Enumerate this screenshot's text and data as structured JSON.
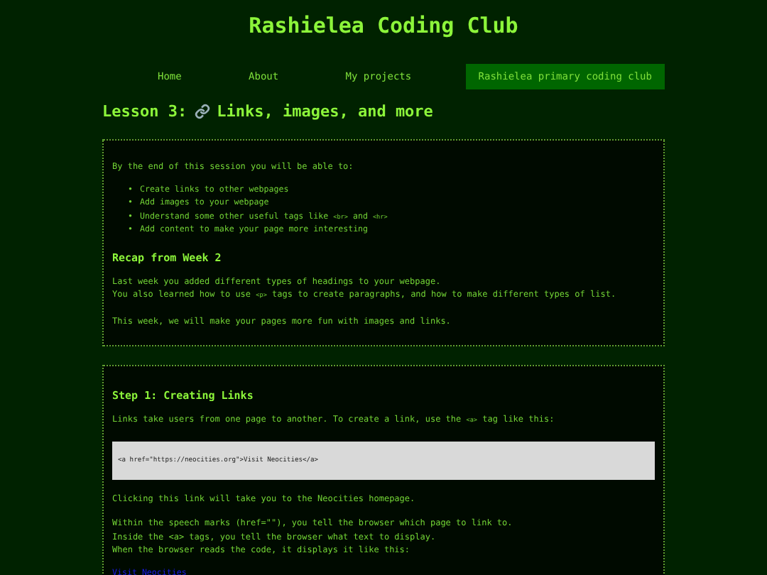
{
  "site_title": "Rashielea Coding Club",
  "nav": [
    {
      "label": "Home",
      "selected": false
    },
    {
      "label": "About",
      "selected": false
    },
    {
      "label": "My projects",
      "selected": false
    },
    {
      "label": "Rashielea primary coding club",
      "selected": true
    }
  ],
  "lesson_title": {
    "before": "Lesson 3:",
    "after": "Links, images, and more"
  },
  "intro": {
    "lead": "By the end of this session you will be able to:",
    "goals": [
      {
        "bullet": "•",
        "parts": [
          {
            "kind": "text",
            "text": "Create links to other webpages"
          }
        ]
      },
      {
        "bullet": "•",
        "parts": [
          {
            "kind": "text",
            "text": "Add images to your webpage"
          }
        ]
      },
      {
        "bullet": "•",
        "parts": [
          {
            "kind": "text",
            "text": "Understand some other useful tags like "
          },
          {
            "kind": "code",
            "text": "<br>"
          },
          {
            "kind": "text",
            "text": " and "
          },
          {
            "kind": "code",
            "text": "<hr>"
          }
        ]
      },
      {
        "bullet": "•",
        "parts": [
          {
            "kind": "text",
            "text": "Add content to make your page more interesting"
          }
        ]
      }
    ],
    "recap_heading": "Recap from Week 2",
    "recap": [
      [
        {
          "kind": "text",
          "text": "Last week you added different types of headings to your webpage."
        },
        {
          "kind": "break"
        },
        {
          "kind": "text",
          "text": "You also learned how to use "
        },
        {
          "kind": "code",
          "text": "<p>"
        },
        {
          "kind": "text",
          "text": " tags to create paragraphs, and how to make different types of list."
        }
      ],
      [
        {
          "kind": "text",
          "text": "This week, we will make your pages more fun with images and links."
        }
      ]
    ]
  },
  "step1": {
    "heading": "Step 1: Creating Links",
    "before_code": [
      {
        "kind": "text",
        "text": "Links take users from one page to another. To create a link, use the "
      },
      {
        "kind": "code",
        "text": "<a>"
      },
      {
        "kind": "text",
        "text": " tag like this:"
      }
    ],
    "code": "<a href=\"https://neocities.org\">Visit Neocities</a>",
    "after_code": [
      [
        {
          "kind": "text",
          "text": "Clicking this link will take you to the Neocities homepage."
        }
      ],
      [
        {
          "kind": "text",
          "text": "Within the speech marks (href=\"\"), you tell the browser which page to link to."
        },
        {
          "kind": "break"
        },
        {
          "kind": "text",
          "text": "Inside the <a> tags, you tell the browser what text to display."
        },
        {
          "kind": "break"
        },
        {
          "kind": "text",
          "text": "When the browser reads the code, it displays it like this:"
        }
      ]
    ],
    "link": "Visit Neocities"
  }
}
